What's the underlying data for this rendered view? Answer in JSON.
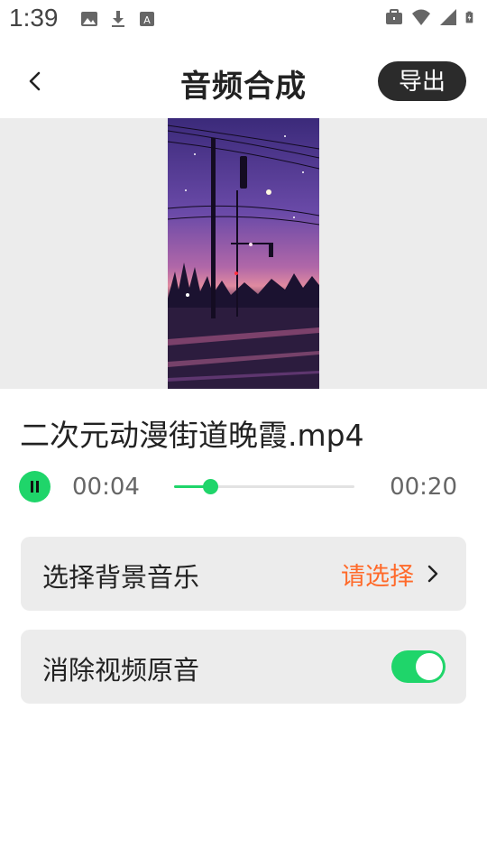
{
  "status_bar": {
    "time": "1:39",
    "left_icons": [
      "image-icon",
      "download-icon",
      "font-icon"
    ],
    "right_icons": [
      "briefcase-icon",
      "wifi-icon",
      "signal-icon",
      "battery-icon"
    ]
  },
  "header": {
    "title": "音频合成",
    "export_label": "导出",
    "back_icon": "chevron-left-icon"
  },
  "video": {
    "file_name": "二次元动漫街道晚霞.mp4",
    "thumbnail_desc_icon": "anime-street-sunset-thumbnail"
  },
  "player": {
    "state_icon": "pause-icon",
    "current_time": "00:04",
    "total_time": "00:20",
    "progress": 0.2
  },
  "settings": {
    "music": {
      "label": "选择背景音乐",
      "value": "请选择",
      "icon": "chevron-right-icon"
    },
    "mute": {
      "label": "消除视频原音",
      "enabled": true
    }
  },
  "colors": {
    "accent": "#1fd56a",
    "select_value": "#ff6a2a",
    "export_button": "#2b2b2b",
    "card_background": "#ececec"
  }
}
